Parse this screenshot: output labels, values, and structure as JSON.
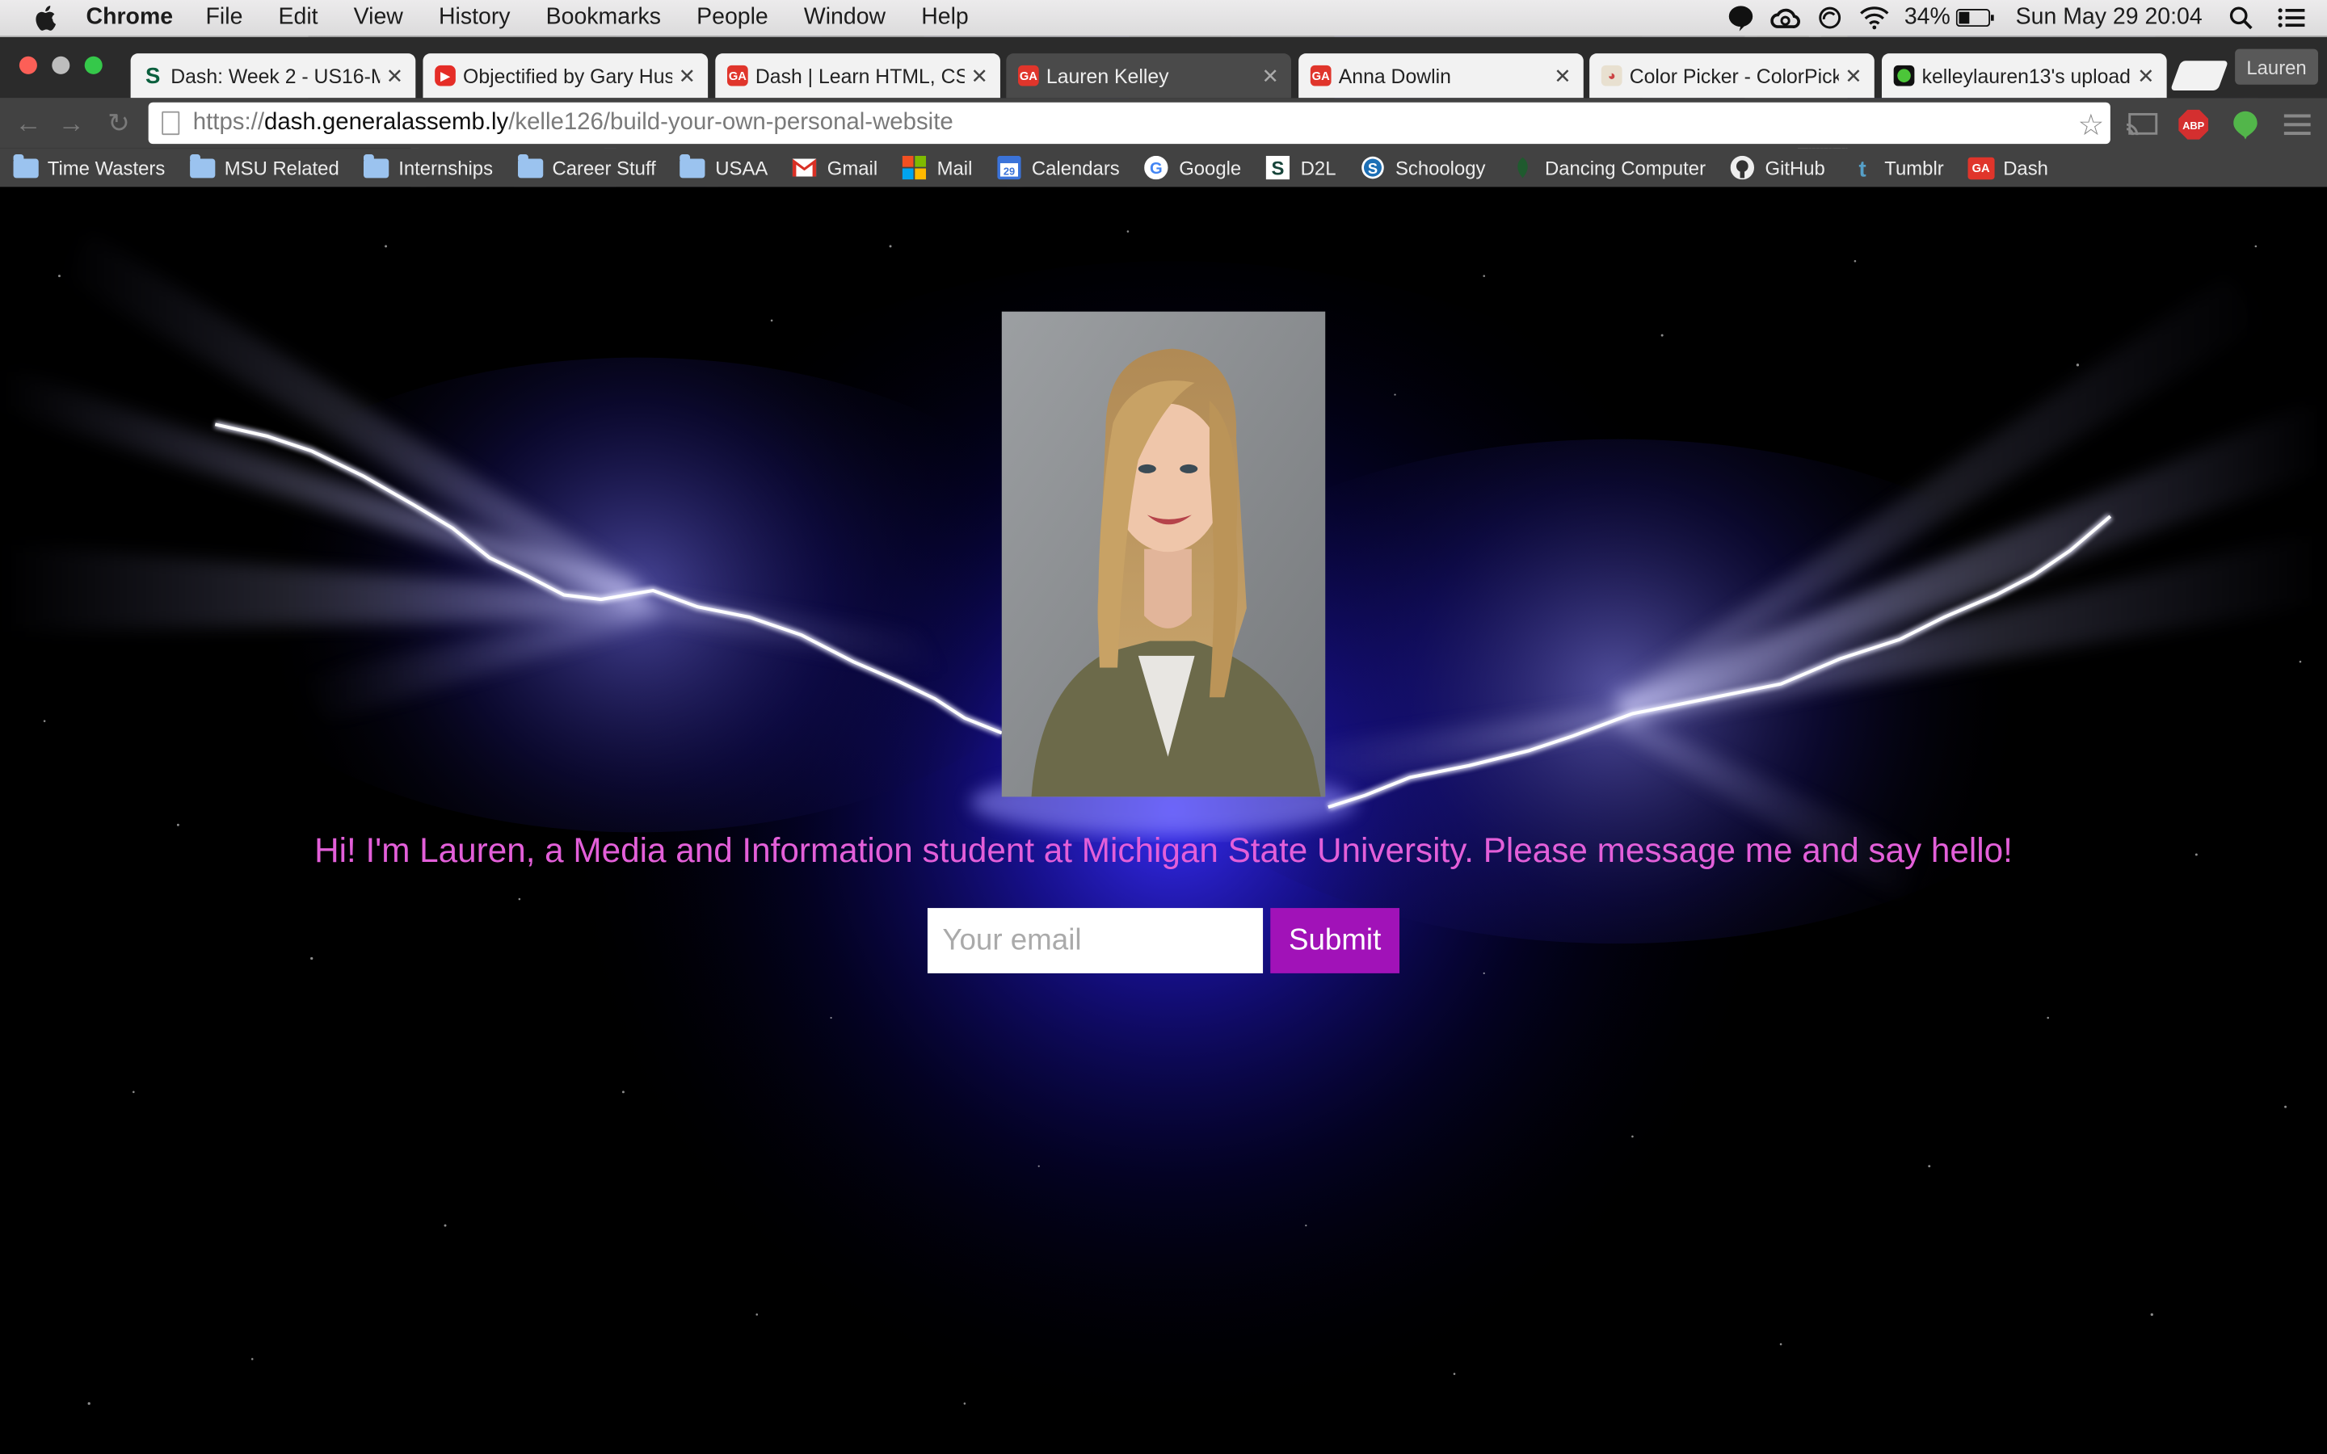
{
  "menubar": {
    "app": "Chrome",
    "items": [
      "File",
      "Edit",
      "View",
      "History",
      "Bookmarks",
      "People",
      "Window",
      "Help"
    ],
    "battery": "34%",
    "datetime": "Sun May 29  20:04"
  },
  "tabs": [
    {
      "title": "Dash: Week 2 - US16-M",
      "favicon": "msu-s-icon",
      "active": false
    },
    {
      "title": "Objectified by Gary Hust",
      "favicon": "youtube-icon",
      "active": false
    },
    {
      "title": "Dash | Learn HTML, CSS",
      "favicon": "ga-icon",
      "active": false
    },
    {
      "title": "Lauren Kelley",
      "favicon": "ga-icon",
      "active": true
    },
    {
      "title": "Anna Dowlin",
      "favicon": "ga-icon",
      "active": false
    },
    {
      "title": "Color Picker - ColorPicke",
      "favicon": "palette-icon",
      "active": false
    },
    {
      "title": "kelleylauren13's uploade",
      "favicon": "green-dot-icon",
      "active": false
    }
  ],
  "profile": "Lauren",
  "address": {
    "scheme": "https://",
    "host": "dash.generalassemb.ly",
    "path": "/kelle126/build-your-own-personal-website"
  },
  "bookmarks": [
    "Time Wasters",
    "MSU Related",
    "Internships",
    "Career Stuff",
    "USAA",
    "Gmail",
    "Mail",
    "Calendars",
    "Google",
    "D2L",
    "Schoology",
    "Dancing Computer",
    "GitHub",
    "Tumblr",
    "Dash"
  ],
  "page": {
    "intro": "Hi! I'm Lauren, a Media and Information student at Michigan State University. Please message me and say hello!",
    "email_placeholder": "Your email",
    "submit_label": "Submit"
  },
  "colors": {
    "intro_text": "#e35fd9",
    "submit_bg": "#a112b8",
    "glow": "#2a22d8"
  }
}
